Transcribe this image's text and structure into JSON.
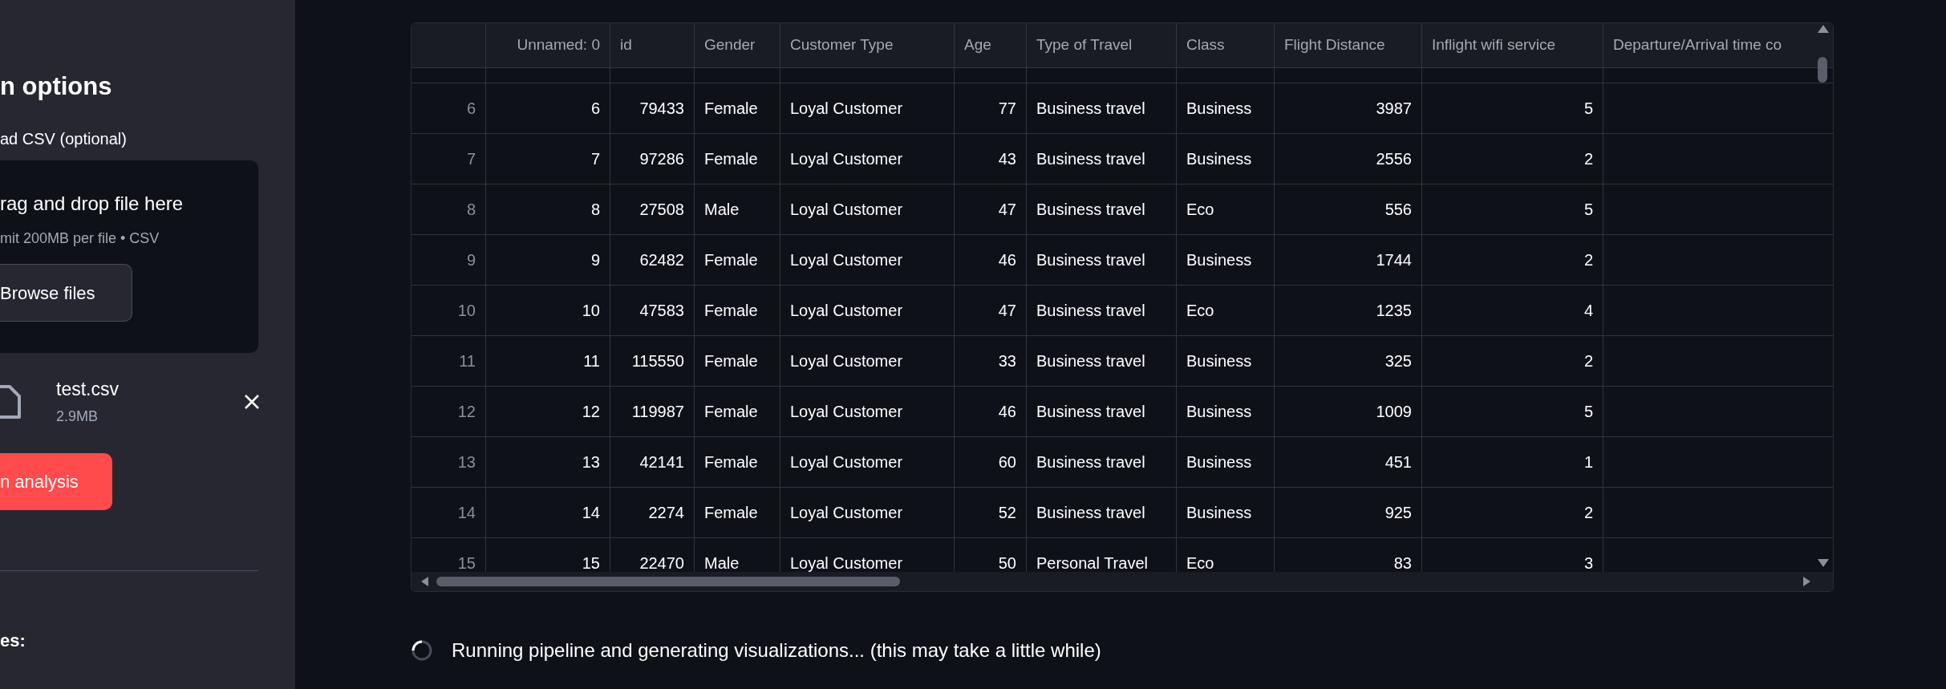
{
  "sidebar": {
    "heading": "n options",
    "upload_label": "ad CSV (optional)",
    "dropzone": {
      "title": "rag and drop file here",
      "hint": "mit 200MB per file • CSV",
      "button": "Browse files"
    },
    "file": {
      "name": "test.csv",
      "size": "2.9MB"
    },
    "run_button": "n analysis",
    "section_label": "es:"
  },
  "table": {
    "columns": [
      "",
      "Unnamed: 0",
      "id",
      "Gender",
      "Customer Type",
      "Age",
      "Type of Travel",
      "Class",
      "Flight Distance",
      "Inflight wifi service",
      "Departure/Arrival time co"
    ],
    "rows": [
      [
        "6",
        "6",
        "79433",
        "Female",
        "Loyal Customer",
        "77",
        "Business travel",
        "Business",
        "3987",
        "5"
      ],
      [
        "7",
        "7",
        "97286",
        "Female",
        "Loyal Customer",
        "43",
        "Business travel",
        "Business",
        "2556",
        "2"
      ],
      [
        "8",
        "8",
        "27508",
        "Male",
        "Loyal Customer",
        "47",
        "Business travel",
        "Eco",
        "556",
        "5"
      ],
      [
        "9",
        "9",
        "62482",
        "Female",
        "Loyal Customer",
        "46",
        "Business travel",
        "Business",
        "1744",
        "2"
      ],
      [
        "10",
        "10",
        "47583",
        "Female",
        "Loyal Customer",
        "47",
        "Business travel",
        "Eco",
        "1235",
        "4"
      ],
      [
        "11",
        "11",
        "115550",
        "Female",
        "Loyal Customer",
        "33",
        "Business travel",
        "Business",
        "325",
        "2"
      ],
      [
        "12",
        "12",
        "119987",
        "Female",
        "Loyal Customer",
        "46",
        "Business travel",
        "Business",
        "1009",
        "5"
      ],
      [
        "13",
        "13",
        "42141",
        "Female",
        "Loyal Customer",
        "60",
        "Business travel",
        "Business",
        "451",
        "1"
      ],
      [
        "14",
        "14",
        "2274",
        "Female",
        "Loyal Customer",
        "52",
        "Business travel",
        "Business",
        "925",
        "2"
      ],
      [
        "15",
        "15",
        "22470",
        "Male",
        "Loyal Customer",
        "50",
        "Personal Travel",
        "Eco",
        "83",
        "3"
      ]
    ]
  },
  "status": {
    "text": "Running pipeline and generating visualizations... (this may take a little while)"
  }
}
